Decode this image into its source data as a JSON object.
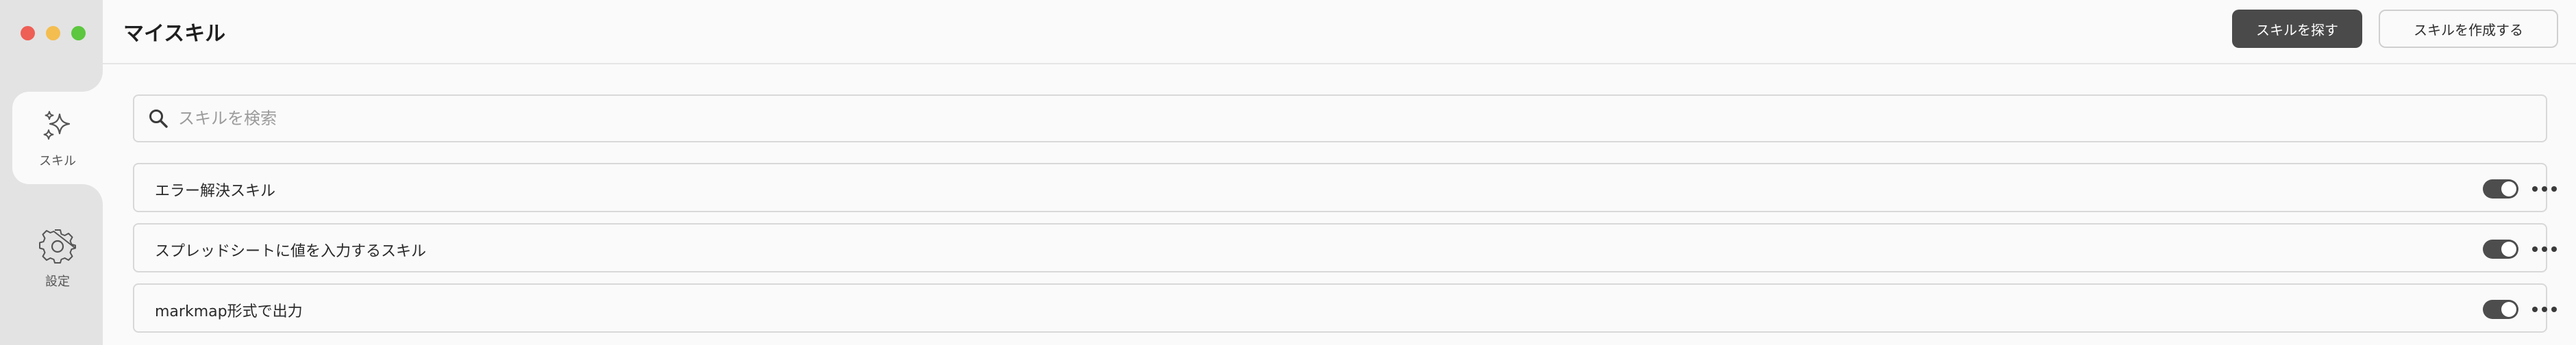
{
  "header": {
    "title": "マイスキル",
    "find_button_label": "スキルを探す",
    "create_button_label": "スキルを作成する"
  },
  "sidebar": {
    "items": [
      {
        "label": "スキル",
        "icon": "sparkles-icon",
        "active": true
      },
      {
        "label": "設定",
        "icon": "gear-icon",
        "active": false
      }
    ]
  },
  "search": {
    "placeholder": "スキルを検索",
    "value": ""
  },
  "skills": [
    {
      "name": "エラー解決スキル",
      "enabled": true
    },
    {
      "name": "スプレッドシートに値を入力するスキル",
      "enabled": true
    },
    {
      "name": "markmap形式で出力",
      "enabled": true
    }
  ],
  "colors": {
    "accent_dark": "#4a4a4a",
    "traffic_red": "#ee5f56",
    "traffic_yellow": "#f4bd4f",
    "traffic_green": "#5cc73f"
  }
}
